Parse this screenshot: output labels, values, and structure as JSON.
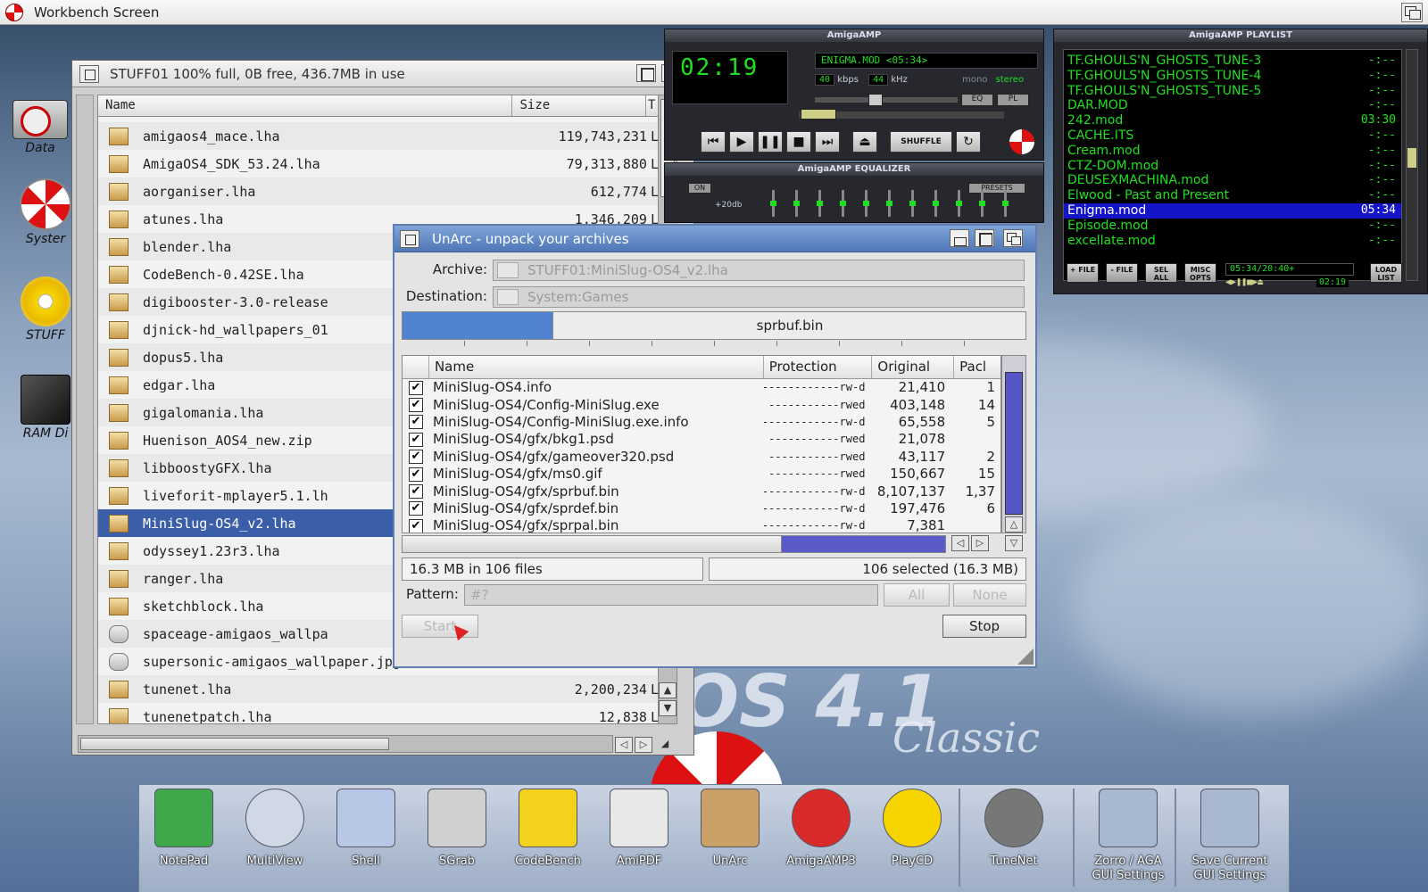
{
  "screen": {
    "title": "Workbench Screen"
  },
  "desktop_icons": [
    {
      "label": "Data",
      "icon": "hard-disk-icon"
    },
    {
      "label": "Syster",
      "icon": "system-disk-icon"
    },
    {
      "label": "STUFF",
      "icon": "cd-disk-icon"
    },
    {
      "label": "RAM Di",
      "icon": "ram-disk-icon"
    }
  ],
  "drawer": {
    "title": "STUFF01  100% full, 0B free, 436.7MB in use",
    "col_name": "Name",
    "col_size": "Size",
    "col_type": "T",
    "files": [
      {
        "name": "amigaos4_mace.lha",
        "size": "119,743,231",
        "type": "L"
      },
      {
        "name": "AmigaOS4_SDK_53.24.lha",
        "size": "79,313,880",
        "type": "L"
      },
      {
        "name": "aorganiser.lha",
        "size": "612,774",
        "type": "L"
      },
      {
        "name": "atunes.lha",
        "size": "1,346,209",
        "type": "L"
      },
      {
        "name": "blender.lha",
        "size": "",
        "type": ""
      },
      {
        "name": "CodeBench-0.42SE.lha",
        "size": "",
        "type": ""
      },
      {
        "name": "digibooster-3.0-release",
        "size": "",
        "type": ""
      },
      {
        "name": "djnick-hd_wallpapers_01",
        "size": "",
        "type": ""
      },
      {
        "name": "dopus5.lha",
        "size": "",
        "type": ""
      },
      {
        "name": "edgar.lha",
        "size": "",
        "type": ""
      },
      {
        "name": "gigalomania.lha",
        "size": "",
        "type": ""
      },
      {
        "name": "Huenison_AOS4_new.zip",
        "size": "",
        "type": ""
      },
      {
        "name": "libboostyGFX.lha",
        "size": "",
        "type": ""
      },
      {
        "name": "liveforit-mplayer5.1.lh",
        "size": "",
        "type": ""
      },
      {
        "name": "MiniSlug-OS4_v2.lha",
        "size": "",
        "type": "",
        "selected": true
      },
      {
        "name": "odyssey1.23r3.lha",
        "size": "",
        "type": ""
      },
      {
        "name": "ranger.lha",
        "size": "",
        "type": ""
      },
      {
        "name": "sketchblock.lha",
        "size": "",
        "type": ""
      },
      {
        "name": "spaceage-amigaos_wallpa",
        "size": "",
        "type": "",
        "pic": true
      },
      {
        "name": "supersonic-amigaos_wallpaper.jpg",
        "size": "",
        "type": "",
        "pic": true
      },
      {
        "name": "tunenet.lha",
        "size": "2,200,234",
        "type": "L"
      },
      {
        "name": "tunenetpatch.lha",
        "size": "12,838",
        "type": "L"
      }
    ]
  },
  "amp": {
    "title": "AmigaAMP",
    "time": "02:19",
    "ticker": "ENIGMA.MOD <05:34>",
    "kbps_val": "40",
    "kbps_label": "kbps",
    "khz_val": "44",
    "khz_label": "kHz",
    "mono": "mono",
    "stereo": "stereo",
    "eq_btn": "EQ",
    "pl_btn": "PL",
    "shuffle": "SHUFFLE",
    "eq_title": "AmigaAMP EQUALIZER",
    "eq_on": "ON",
    "eq_db": "+20db",
    "eq_presets": "PRESETS",
    "eq_levels": [
      0.5,
      0.5,
      0.5,
      0.5,
      0.5,
      0.5,
      0.5,
      0.5,
      0.5,
      0.5,
      0.5
    ]
  },
  "playlist": {
    "title": "AmigaAMP PLAYLIST",
    "items": [
      {
        "name": "TF.GHOULS'N_GHOSTS_TUNE-3",
        "time": "-:--"
      },
      {
        "name": "TF.GHOULS'N_GHOSTS_TUNE-4",
        "time": "-:--"
      },
      {
        "name": "TF.GHOULS'N_GHOSTS_TUNE-5",
        "time": "-:--"
      },
      {
        "name": "DAR.MOD",
        "time": "-:--"
      },
      {
        "name": "242.mod",
        "time": "03:30"
      },
      {
        "name": "CACHE.ITS",
        "time": "-:--"
      },
      {
        "name": "Cream.mod",
        "time": "-:--"
      },
      {
        "name": "CTZ-DOM.mod",
        "time": "-:--"
      },
      {
        "name": "DEUSEXMACHINA.mod",
        "time": "-:--"
      },
      {
        "name": "Elwood - Past and Present",
        "time": "-:--"
      },
      {
        "name": "Enigma.mod",
        "time": "05:34",
        "current": true
      },
      {
        "name": "Episode.mod",
        "time": "-:--"
      },
      {
        "name": "excellate.mod",
        "time": "-:--"
      }
    ],
    "buttons": [
      "+ FILE",
      "- FILE",
      "SEL ALL",
      "MISC OPTS",
      "LOAD LIST"
    ],
    "total": "05:34/20:40+",
    "elapsed": "02:19"
  },
  "unarc": {
    "title": "UnArc - unpack your archives",
    "archive_label": "Archive:",
    "archive_value": "STUFF01:MiniSlug-OS4_v2.lha",
    "dest_label": "Destination:",
    "dest_value": "System:Games",
    "progress_text": "sprbuf.bin",
    "progress_fraction": 0.24,
    "col_name": "Name",
    "col_protection": "Protection",
    "col_original": "Original",
    "col_packed": "Pacl",
    "rows": [
      {
        "name": "MiniSlug-OS4.info",
        "prot": "------------rw-d",
        "orig": "21,410",
        "packed": "1"
      },
      {
        "name": "MiniSlug-OS4/Config-MiniSlug.exe",
        "prot": "-----------rwed",
        "orig": "403,148",
        "packed": "14"
      },
      {
        "name": "MiniSlug-OS4/Config-MiniSlug.exe.info",
        "prot": "------------rw-d",
        "orig": "65,558",
        "packed": "5"
      },
      {
        "name": "MiniSlug-OS4/gfx/bkg1.psd",
        "prot": "-----------rwed",
        "orig": "21,078",
        "packed": ""
      },
      {
        "name": "MiniSlug-OS4/gfx/gameover320.psd",
        "prot": "-----------rwed",
        "orig": "43,117",
        "packed": "2"
      },
      {
        "name": "MiniSlug-OS4/gfx/ms0.gif",
        "prot": "-----------rwed",
        "orig": "150,667",
        "packed": "15"
      },
      {
        "name": "MiniSlug-OS4/gfx/sprbuf.bin",
        "prot": "------------rw-d",
        "orig": "8,107,137",
        "packed": "1,37"
      },
      {
        "name": "MiniSlug-OS4/gfx/sprdef.bin",
        "prot": "------------rw-d",
        "orig": "197,476",
        "packed": "6"
      },
      {
        "name": "MiniSlug-OS4/gfx/sprpal.bin",
        "prot": "------------rw-d",
        "orig": "7,381",
        "packed": ""
      }
    ],
    "summary": "16.3 MB in 106 files",
    "selected": "106 selected (16.3 MB)",
    "pattern_label": "Pattern:",
    "pattern_value": "#?",
    "all_btn": "All",
    "none_btn": "None",
    "start_btn": "Start",
    "stop_btn": "Stop"
  },
  "logo": {
    "text": "OS 4.1",
    "sub": "Classic"
  },
  "dock": [
    {
      "label": "NotePad",
      "icon": "notepad-icon",
      "color": "#3fa84a"
    },
    {
      "label": "MultiView",
      "icon": "magnifier-icon",
      "color": "#cfd8e4"
    },
    {
      "label": "Shell",
      "icon": "shell-icon",
      "color": "#b7c8e6"
    },
    {
      "label": "SGrab",
      "icon": "camera-icon",
      "color": "#d0d0d0"
    },
    {
      "label": "CodeBench",
      "icon": "codebench-icon",
      "color": "#f2d21c"
    },
    {
      "label": "AmiPDF",
      "icon": "pdf-icon",
      "color": "#e8e8e8"
    },
    {
      "label": "UnArc",
      "icon": "unarc-icon",
      "color": "#c9a065"
    },
    {
      "label": "AmigaAMP3",
      "icon": "amigaamp-icon",
      "color": "#d92a2a"
    },
    {
      "label": "PlayCD",
      "icon": "playcd-icon",
      "color": "#f5d400"
    },
    {
      "label": "TuneNet",
      "icon": "speaker-icon",
      "color": "#777777"
    },
    {
      "label": "Zorro / AGA GUI Settings",
      "icon": "gui-settings-icon",
      "color": "#a8b8d0"
    },
    {
      "label": "Save Current GUI Settings",
      "icon": "save-gui-icon",
      "color": "#a8b8d0"
    }
  ]
}
